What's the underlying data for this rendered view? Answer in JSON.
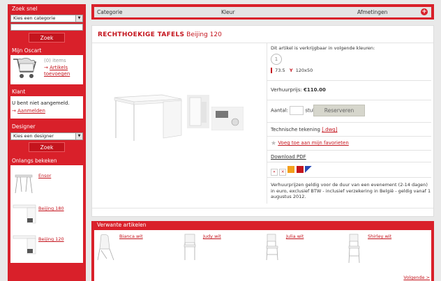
{
  "sidebar": {
    "search": {
      "title": "Zoek snel",
      "category_select": "Kies een categorie",
      "button": "Zoek"
    },
    "mijn_oscart": {
      "title": "Mijn Oscart",
      "items": "(0) items",
      "link_line1": "Artikels",
      "link_line2": "toevoegen"
    },
    "klant": {
      "title": "Klant",
      "status": "U bent niet aangemeld.",
      "login": "Aanmelden"
    },
    "designer": {
      "title": "Designer",
      "select": "Kies een designer",
      "button": "Zoek"
    },
    "recent": {
      "title": "Onlangs bekeken",
      "items": [
        "Ensor",
        "Beijing 180",
        "Beijing 120"
      ]
    }
  },
  "filters": {
    "categorie": "Categorie",
    "kleur": "Kleur",
    "afmetingen": "Afmetingen"
  },
  "product": {
    "title_bold": "RECHTHOEKIGE TAFELS",
    "title_name": "Beijing 120",
    "colors_text": "Dit artikel is verkrijgbaar in volgende kleuren:",
    "color_count": "1",
    "height": "73.5",
    "size": "120x50",
    "price_label": "Verhuurprijs:",
    "price": "€110.00",
    "qty_label": "Aantal:",
    "qty_unit": "stuks",
    "reserve_button": "Reserveren",
    "tech_drawing_label": "Technische tekening",
    "tech_drawing_link": "[.dwg]",
    "favorite": "Voeg toe aan mijn favorieten",
    "download": "Download PDF",
    "note": "Verhuurprijzen geldig voor de duur van een evenement (2-14 dagen) in euro, exclusief BTW - inclusief verzekering in België - geldig vanaf 1 augustus 2012."
  },
  "related": {
    "title": "Verwante artikelen",
    "items": [
      "Bianca wit",
      "Judy wit",
      "Julia wit",
      "Shirley wit"
    ],
    "next": "Volgende >"
  },
  "colors": {
    "brand_red": "#d9202a",
    "link_red": "#c4141d"
  }
}
